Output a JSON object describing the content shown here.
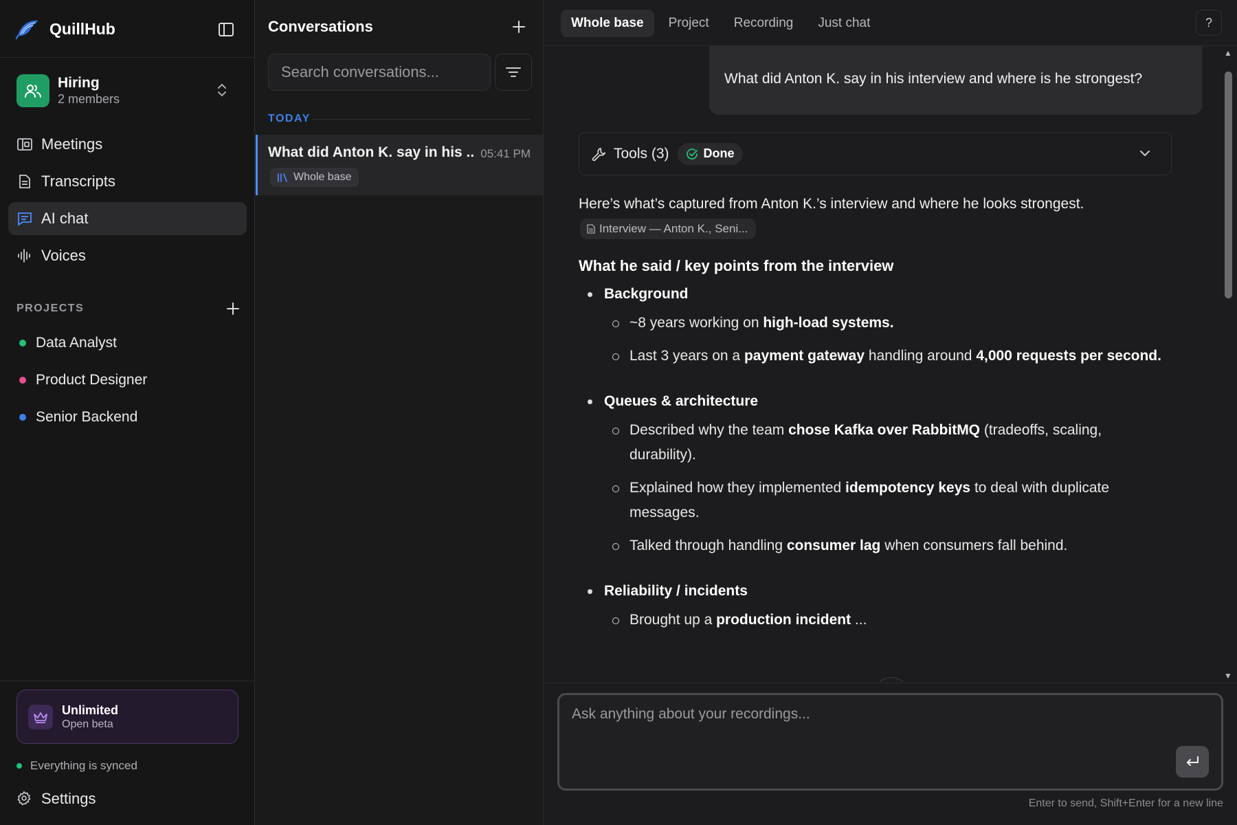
{
  "app": {
    "name": "QuillHub"
  },
  "workspace": {
    "name": "Hiring",
    "members": "2 members"
  },
  "nav": [
    {
      "label": "Meetings",
      "icon": "meetings-icon",
      "active": false
    },
    {
      "label": "Transcripts",
      "icon": "transcript-icon",
      "active": false
    },
    {
      "label": "AI chat",
      "icon": "chat-icon",
      "active": true
    },
    {
      "label": "Voices",
      "icon": "waveform-icon",
      "active": false
    }
  ],
  "projects": {
    "label": "PROJECTS",
    "items": [
      {
        "label": "Data Analyst",
        "color": "#22c17a"
      },
      {
        "label": "Product Designer",
        "color": "#e5508a"
      },
      {
        "label": "Senior Backend",
        "color": "#3f7fe8"
      }
    ]
  },
  "plan": {
    "title": "Unlimited",
    "subtitle": "Open beta"
  },
  "sync": {
    "status": "Everything is synced",
    "color": "#22c17a"
  },
  "settings": {
    "label": "Settings"
  },
  "conversations": {
    "title": "Conversations",
    "search_placeholder": "Search conversations...",
    "group_label": "TODAY",
    "items": [
      {
        "title": "What did Anton K. say in his ...",
        "time": "05:41 PM",
        "tag": "Whole base"
      }
    ]
  },
  "chat": {
    "tabs": [
      "Whole base",
      "Project",
      "Recording",
      "Just chat"
    ],
    "active_tab": "Whole base",
    "help": "?",
    "user_message": "What did Anton K. say in his interview and where is he strongest?",
    "tools": {
      "label": "Tools (3)",
      "status": "Done"
    },
    "answer": {
      "intro": "Here’s what’s captured from Anton K.’s interview and where he looks strongest.",
      "source": "Interview — Anton K., Seni...",
      "heading": "What he said / key points from the interview",
      "sections": [
        {
          "title": "Background",
          "points": [
            {
              "parts": [
                [
                  "~8 years working on ",
                  false
                ],
                [
                  "high-load systems.",
                  true
                ]
              ]
            },
            {
              "parts": [
                [
                  "Last 3 years on a ",
                  false
                ],
                [
                  "payment gateway",
                  true
                ],
                [
                  " handling around ",
                  false
                ],
                [
                  "4,000 requests per second.",
                  true
                ]
              ]
            }
          ]
        },
        {
          "title": "Queues & architecture",
          "points": [
            {
              "parts": [
                [
                  "Described why the team ",
                  false
                ],
                [
                  "chose Kafka over RabbitMQ",
                  true
                ],
                [
                  " (tradeoffs, scaling, durability).",
                  false
                ]
              ]
            },
            {
              "parts": [
                [
                  "Explained how they implemented ",
                  false
                ],
                [
                  "idempotency keys",
                  true
                ],
                [
                  " to deal with duplicate messages.",
                  false
                ]
              ]
            },
            {
              "parts": [
                [
                  "Talked through handling ",
                  false
                ],
                [
                  "consumer lag",
                  true
                ],
                [
                  " when consumers fall behind.",
                  false
                ]
              ]
            }
          ]
        },
        {
          "title": "Reliability / incidents",
          "points": [
            {
              "parts": [
                [
                  "Brought up a ",
                  false
                ],
                [
                  "production incident",
                  true
                ],
                [
                  " ...",
                  false
                ]
              ]
            }
          ]
        }
      ]
    },
    "composer": {
      "placeholder": "Ask anything about your recordings...",
      "hint": "Enter to send, Shift+Enter for a new line"
    }
  }
}
